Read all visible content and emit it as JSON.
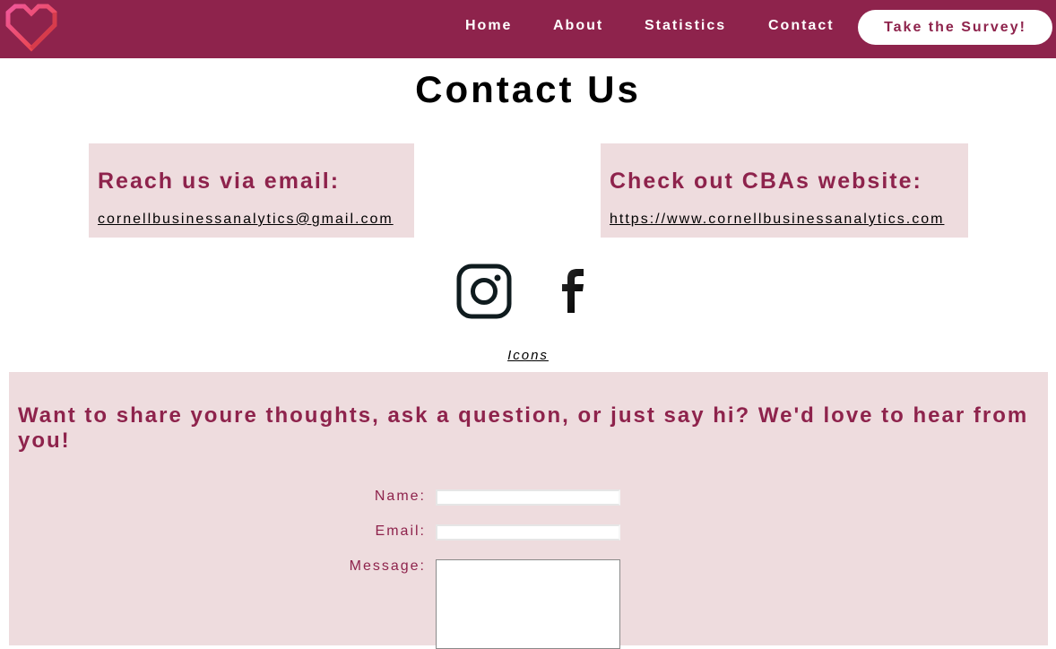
{
  "nav": {
    "logo": "heart-logo",
    "links": [
      "Home",
      "About",
      "Statistics",
      "Contact"
    ],
    "survey_button": "Take the Survey!"
  },
  "page": {
    "title": "Contact Us"
  },
  "cards": {
    "email": {
      "heading": "Reach us via email:",
      "link": "cornellbusinessanalytics@gmail.com"
    },
    "website": {
      "heading": "Check out CBAs website:",
      "link": "https://www.cornellbusinessanalytics.com"
    }
  },
  "social": {
    "icons": [
      "instagram-icon",
      "facebook-icon"
    ],
    "credit": "Icons"
  },
  "form": {
    "heading": "Want to share youre thoughts, ask a question, or just say hi? We'd love to hear from you!",
    "name_label": "Name:",
    "name_value": "",
    "email_label": "Email:",
    "email_value": "",
    "message_label": "Message:",
    "message_value": ""
  },
  "colors": {
    "brand": "#8e234c",
    "panel": "#eedcde",
    "logo_gradient_start": "#f0589b",
    "logo_gradient_end": "#e8423b"
  }
}
